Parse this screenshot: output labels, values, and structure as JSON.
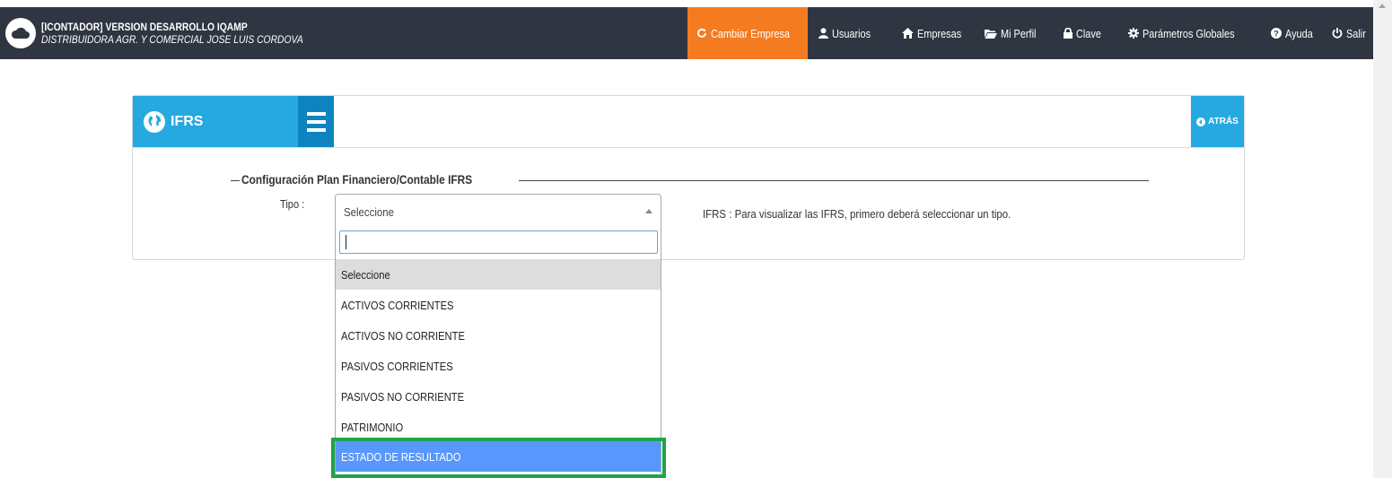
{
  "app": {
    "title": "[ICONTADOR] VERSION DESARROLLO IQAMP",
    "company": "DISTRIBUIDORA AGR. Y COMERCIAL JOSE LUIS CORDOVA",
    "logo_icon": "cloud-icon"
  },
  "nav": {
    "cambiar_empresa": "Cambiar Empresa",
    "usuarios": "Usuarios",
    "empresas": "Empresas",
    "mi_perfil": "Mi Perfil",
    "clave": "Clave",
    "parametros": "Parámetros Globales",
    "ayuda": "Ayuda",
    "salir": "Salir",
    "active_color": "#f47b20"
  },
  "panel": {
    "title": "IFRS",
    "back_label": "ATRÁS",
    "accent": "#26a9e0"
  },
  "form": {
    "legend": "Configuración Plan Financiero/Contable IFRS",
    "tipo_label": "Tipo :",
    "selected_value": "Seleccione",
    "search_value": "",
    "info": "IFRS : Para visualizar las IFRS, primero deberá seleccionar un tipo."
  },
  "dropdown": {
    "options": [
      "Seleccione",
      "ACTIVOS CORRIENTES",
      "ACTIVOS NO CORRIENTE",
      "PASIVOS CORRIENTES",
      "PASIVOS NO CORRIENTE",
      "PATRIMONIO",
      "ESTADO DE RESULTADO"
    ],
    "selected_index": 0,
    "highlighted_index": 6,
    "highlight_color": "#5897fb",
    "outline_color": "#1fa44a"
  }
}
